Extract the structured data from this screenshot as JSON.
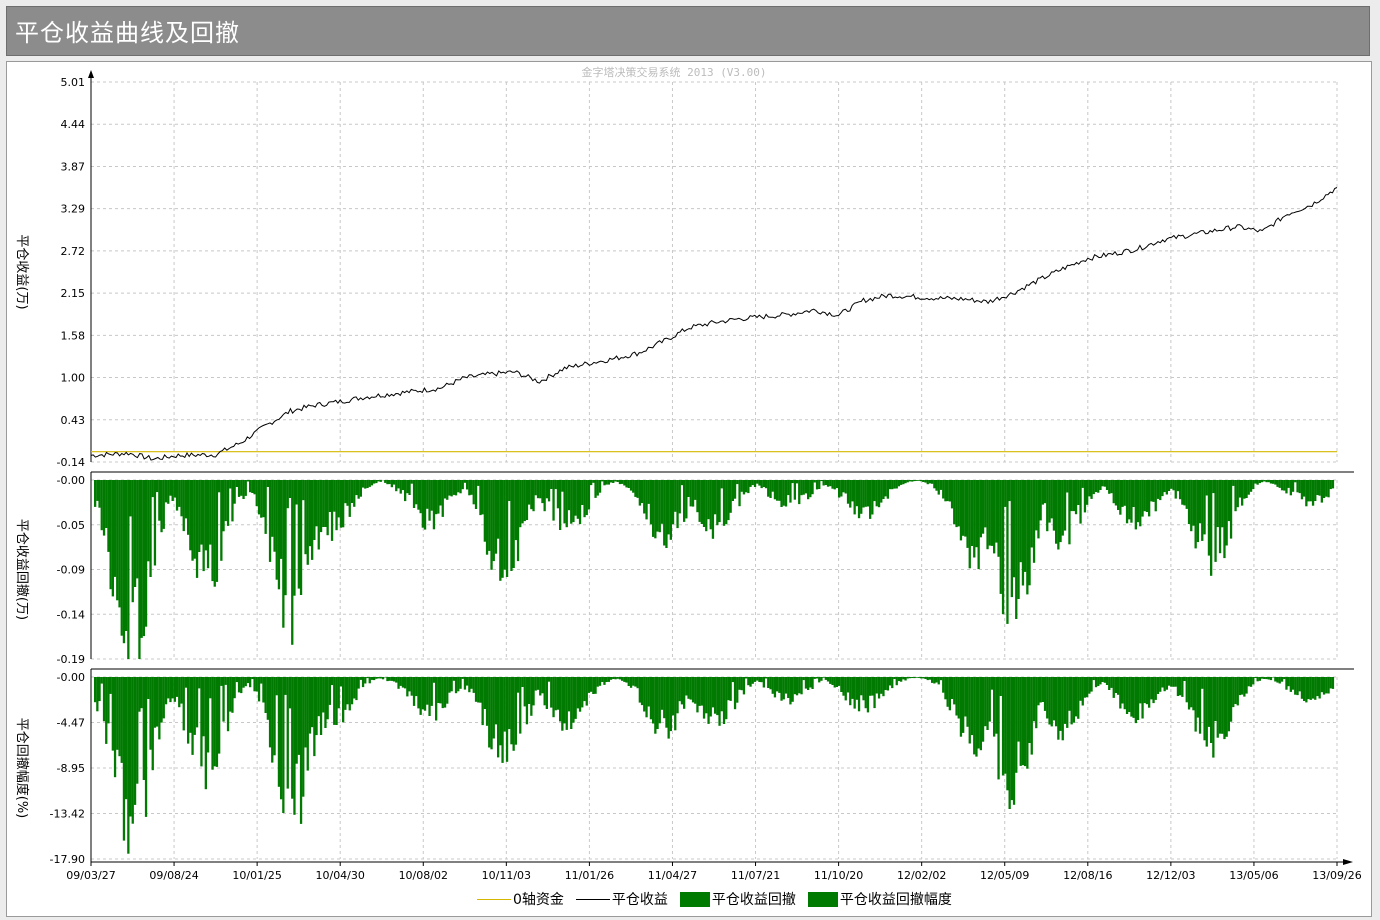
{
  "window": {
    "title": "平仓收益曲线及回撤"
  },
  "colors": {
    "equity": "#000000",
    "zero_axis": "#d4b800",
    "drawdown": "#007a00",
    "title_bar": "#8c8c8c"
  },
  "chart_data": [
    {
      "type": "line",
      "watermark": "金字塔决策交易系统 2013 (V3.00)",
      "ylabel": "平仓收益(万)",
      "ylim": [
        -0.14,
        5.01
      ],
      "yticks": [
        "5.01",
        "4.44",
        "3.87",
        "3.29",
        "2.72",
        "2.15",
        "1.58",
        "1.00",
        "0.43",
        "-0.14"
      ],
      "grid": true,
      "series": [
        {
          "name": "0轴资金",
          "values_const": 0.0
        },
        {
          "name": "平仓收益",
          "x": [
            0,
            3,
            5,
            7,
            10,
            12,
            14,
            16,
            18,
            20,
            22,
            25,
            28,
            30,
            32,
            34,
            36,
            38,
            40,
            42,
            44,
            46,
            48,
            50,
            52,
            54,
            56,
            58,
            60,
            62,
            64,
            66,
            68,
            70,
            72,
            74,
            76,
            78,
            80,
            82,
            84,
            86,
            88,
            90,
            92,
            94,
            96,
            98,
            100
          ],
          "values": [
            -0.05,
            -0.02,
            -0.1,
            -0.05,
            -0.04,
            0.12,
            0.35,
            0.55,
            0.63,
            0.68,
            0.74,
            0.8,
            0.86,
            1.0,
            1.05,
            1.08,
            0.95,
            1.13,
            1.2,
            1.26,
            1.34,
            1.5,
            1.68,
            1.75,
            1.8,
            1.83,
            1.86,
            1.92,
            1.85,
            2.05,
            2.12,
            2.1,
            2.08,
            2.07,
            2.03,
            2.15,
            2.32,
            2.48,
            2.62,
            2.68,
            2.75,
            2.87,
            2.93,
            2.99,
            3.05,
            2.98,
            3.22,
            3.35,
            3.58
          ]
        }
      ],
      "xtick_labels": [
        "09/03/27",
        "09/08/24",
        "10/01/25",
        "10/04/30",
        "10/08/02",
        "10/11/03",
        "11/01/26",
        "11/04/27",
        "11/07/21",
        "11/10/20",
        "12/02/02",
        "12/05/09",
        "12/08/16",
        "12/12/03",
        "13/05/06",
        "13/09/26"
      ]
    },
    {
      "type": "bar",
      "ylabel": "平仓收益回撤(万)",
      "ylim": [
        -0.19,
        0.0
      ],
      "yticks": [
        "-0.00",
        "-0.05",
        "-0.09",
        "-0.14",
        "-0.19"
      ],
      "series": [
        {
          "name": "平仓收益回撤"
        }
      ]
    },
    {
      "type": "bar",
      "ylabel": "平仓回撤幅度(%)",
      "ylim": [
        -17.9,
        0.0
      ],
      "yticks": [
        "-0.00",
        "-4.47",
        "-8.95",
        "-13.42",
        "-17.90"
      ],
      "series": [
        {
          "name": "平仓收益回撤幅度"
        }
      ]
    }
  ],
  "legend": [
    {
      "label": "0轴资金",
      "kind": "line",
      "color": "#d4b800"
    },
    {
      "label": "平仓收益",
      "kind": "line",
      "color": "#000000"
    },
    {
      "label": "平仓收益回撤",
      "kind": "box",
      "color": "#007a00"
    },
    {
      "label": "平仓收益回撤幅度",
      "kind": "box",
      "color": "#007a00"
    }
  ]
}
